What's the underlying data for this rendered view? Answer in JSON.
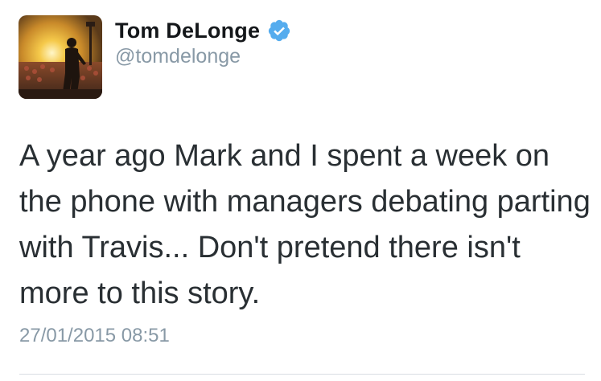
{
  "tweet": {
    "author": {
      "display_name": "Tom DeLonge",
      "handle": "@tomdelonge",
      "verified": true,
      "verified_color": "#55acee"
    },
    "text": "A year ago Mark and I spent a week on the phone with managers debating parting with Travis... Don't pretend there isn't more to this story.",
    "timestamp": "27/01/2015 08:51"
  },
  "colors": {
    "name": "#14171a",
    "secondary": "#8899a6",
    "body_text": "#292f33",
    "divider": "#d8dde3"
  }
}
